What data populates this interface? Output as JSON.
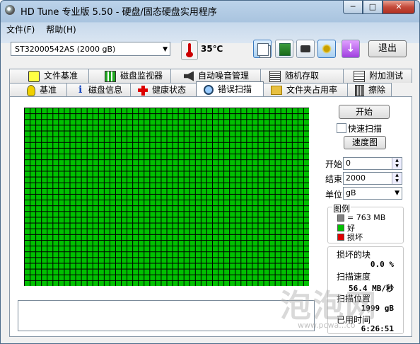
{
  "window": {
    "title": "HD Tune 专业版 5.50 - 硬盘/固态硬盘实用程序"
  },
  "window_controls": {
    "minimize": "─",
    "maximize": "□",
    "close": "✕"
  },
  "menu": [
    "文件(F)",
    "帮助(H)"
  ],
  "toolbar": {
    "drive": "ST32000542AS  (2000 gB)",
    "temperature": "35℃",
    "exit_label": "退出",
    "tool_icons": [
      "copy-info-icon",
      "copy-screen-icon",
      "screenshot-camera-icon",
      "options-icon",
      "save-icon"
    ]
  },
  "tabs_row1": [
    {
      "label": "文件基准",
      "icon": "file-benchmark-icon"
    },
    {
      "label": "磁盘监视器",
      "icon": "disk-monitor-icon"
    },
    {
      "label": "自动噪音管理",
      "icon": "speaker-icon"
    },
    {
      "label": "随机存取",
      "icon": "random-access-icon"
    },
    {
      "label": "附加测试",
      "icon": "extra-tests-icon"
    }
  ],
  "tabs_row2": [
    {
      "label": "基准",
      "icon": "bulb-icon"
    },
    {
      "label": "磁盘信息",
      "icon": "info-icon"
    },
    {
      "label": "健康状态",
      "icon": "health-cross-icon"
    },
    {
      "label": "错误扫描",
      "icon": "magnifier-icon",
      "selected": true
    },
    {
      "label": "文件夹占用率",
      "icon": "folder-icon"
    },
    {
      "label": "擦除",
      "icon": "trash-icon"
    }
  ],
  "scan_grid": {
    "status": "good",
    "color_good": "#00c000",
    "color_grid": "#000000"
  },
  "controls": {
    "start_button": "开始",
    "quick_scan_label": "快速扫描",
    "quick_scan_checked": false,
    "speed_map_button": "速度图",
    "start_label": "开始",
    "start_value": "0",
    "end_label": "结束",
    "end_value": "2000",
    "unit_label": "单位",
    "unit_value": "gB"
  },
  "legend": {
    "title": "图例",
    "items": [
      {
        "label": "= 763 MB",
        "color": "#808080"
      },
      {
        "label": "好",
        "color": "#00c000"
      },
      {
        "label": "损坏",
        "color": "#e00000"
      }
    ]
  },
  "stats": {
    "damaged_label": "损坏的块",
    "damaged_value": "0.0 %",
    "speed_label": "扫描速度",
    "speed_value": "56.4 MB/秒",
    "position_label": "扫描位置",
    "position_value": "1999 gB",
    "elapsed_label": "已用时间",
    "elapsed_value": "6:26:51"
  },
  "watermark": {
    "text": "泡泡网",
    "sub": "www.pcwa...co"
  }
}
